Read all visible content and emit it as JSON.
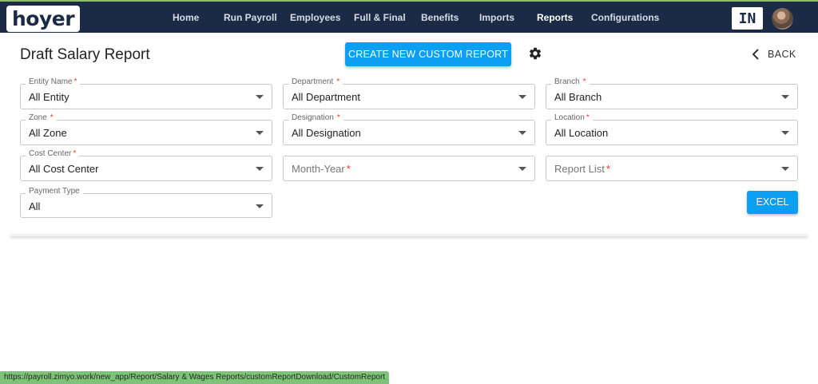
{
  "brand": {
    "logo_text": "hoyer"
  },
  "nav": {
    "items": [
      {
        "label": "Home"
      },
      {
        "label": "Run Payroll"
      },
      {
        "label": "Employees"
      },
      {
        "label": "Full & Final"
      },
      {
        "label": "Benefits"
      },
      {
        "label": "Imports"
      },
      {
        "label": "Reports",
        "active": true
      },
      {
        "label": "Configurations"
      }
    ],
    "country_badge": "IN"
  },
  "page": {
    "title": "Draft Salary Report",
    "create_button": "CREATE NEW CUSTOM REPORT",
    "back_label": "BACK",
    "excel_button": "EXCEL"
  },
  "filters": {
    "entity": {
      "label": "Entity Name",
      "required": "*",
      "value": "All Entity"
    },
    "department": {
      "label": "Department",
      "required": "*",
      "value": "All Department"
    },
    "branch": {
      "label": "Branch",
      "required": "*",
      "value": "All Branch"
    },
    "zone": {
      "label": "Zone",
      "required": "*",
      "value": "All Zone"
    },
    "designation": {
      "label": "Designation",
      "required": "*",
      "value": "All Designation"
    },
    "location": {
      "label": "Location",
      "required": "*",
      "value": "All Location"
    },
    "cost_center": {
      "label": "Cost Center",
      "required": "*",
      "value": "All Cost Center"
    },
    "month_year": {
      "placeholder": "Month-Year",
      "required": "*"
    },
    "report_list": {
      "placeholder": "Report List",
      "required": "*"
    },
    "payment_type": {
      "label": "Payment Type",
      "value": "All"
    }
  },
  "status_bar": {
    "url": "https://payroll.zimyo.work/new_app/Report/Salary & Wages Reports/customReportDownload/CustomReport"
  },
  "colors": {
    "topbar": "#1b2b45",
    "accent": "#0a9ff0",
    "required": "#e53935"
  }
}
